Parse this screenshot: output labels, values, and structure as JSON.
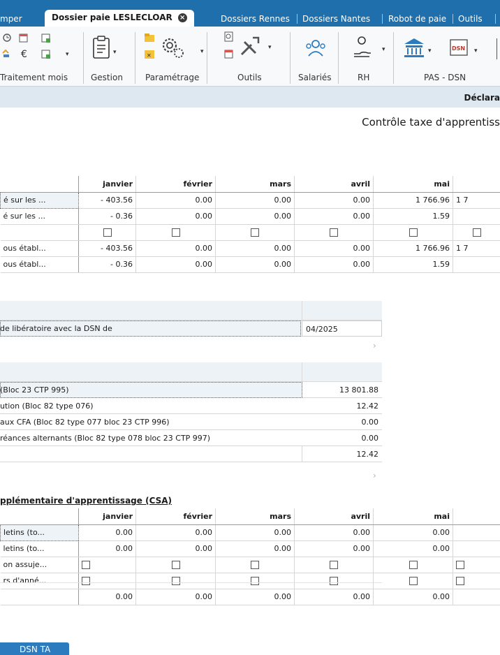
{
  "tabs": [
    {
      "label": "mper",
      "active": false
    },
    {
      "label": "Dossier paie LESLECLOAR",
      "active": true
    },
    {
      "label": "Dossiers Rennes",
      "active": false
    },
    {
      "label": "Dossiers Nantes",
      "active": false
    },
    {
      "label": "Robot de paie",
      "active": false
    },
    {
      "label": "Outils",
      "active": false
    }
  ],
  "ribbon": {
    "groups": [
      "Traitement mois",
      "Gestion",
      "Paramétrage",
      "Outils",
      "Salariés",
      "RH",
      "PAS - DSN"
    ],
    "dsn_icon_text": "DSN"
  },
  "page": {
    "title": "Déclara",
    "subtitle": "Contrôle taxe d'apprentiss"
  },
  "monthly": {
    "months": [
      "janvier",
      "février",
      "mars",
      "avril",
      "mai"
    ],
    "rows": [
      {
        "label": "é sur les ...",
        "values": [
          "- 403.56",
          "0.00",
          "0.00",
          "0.00",
          "1 766.96"
        ],
        "extra": "1 7"
      },
      {
        "label": "é sur les ...",
        "values": [
          "- 0.36",
          "0.00",
          "0.00",
          "0.00",
          "1.59"
        ],
        "extra": ""
      },
      {
        "label": "",
        "checkbox": true
      },
      {
        "label": "ous établ...",
        "values": [
          "- 403.56",
          "0.00",
          "0.00",
          "0.00",
          "1 766.96"
        ],
        "extra": "1 7"
      },
      {
        "label": "ous établ...",
        "values": [
          "- 0.36",
          "0.00",
          "0.00",
          "0.00",
          "1.59"
        ],
        "extra": ""
      }
    ]
  },
  "liberatoire": {
    "label": "de libératoire avec la DSN de",
    "value": "04/2025"
  },
  "blocs": {
    "rows": [
      {
        "label": "(Bloc 23 CTP 995)",
        "value": "13 801.88"
      },
      {
        "label": "ution (Bloc 82 type 076)",
        "value": "12.42"
      },
      {
        "label": "aux CFA (Bloc 82 type 077 bloc 23 CTP 996)",
        "value": "0.00"
      },
      {
        "label": "réances alternants (Bloc 82 type 078 bloc 23 CTP 997)",
        "value": "0.00"
      },
      {
        "label": "",
        "value": "12.42"
      }
    ]
  },
  "csa": {
    "title": "pplémentaire d'apprentissage (CSA)",
    "months": [
      "janvier",
      "février",
      "mars",
      "avril",
      "mai"
    ],
    "rows": [
      {
        "label": "letins (to...",
        "values": [
          "0.00",
          "0.00",
          "0.00",
          "0.00",
          "0.00"
        ]
      },
      {
        "label": "letins (to...",
        "values": [
          "0.00",
          "0.00",
          "0.00",
          "0.00",
          "0.00"
        ]
      },
      {
        "label": "on assuje...",
        "checkbox": true
      },
      {
        "label": "rs d'anné...",
        "checkbox": true
      }
    ],
    "totals": [
      "0.00",
      "0.00",
      "0.00",
      "0.00",
      "0.00"
    ]
  },
  "bottom_tab": "DSN TA"
}
